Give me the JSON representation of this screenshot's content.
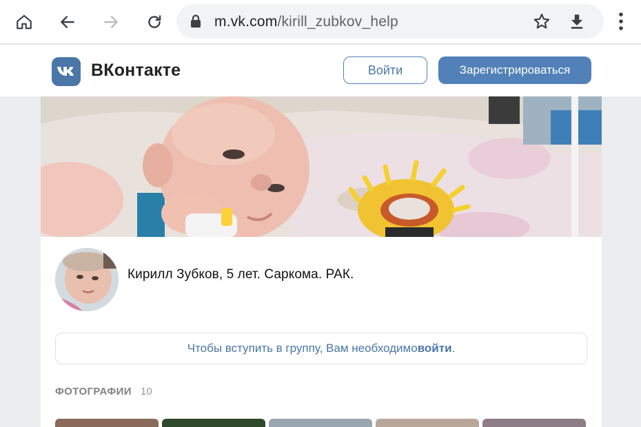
{
  "browser": {
    "url_host": "m.vk.com",
    "url_path": "/kirill_zubkov_help",
    "icons": [
      "home-icon",
      "back-icon",
      "forward-icon",
      "reload-icon",
      "lock-icon",
      "star-icon",
      "download-icon",
      "menu-icon"
    ]
  },
  "header": {
    "logo_text": "VK",
    "brand": "ВКонтакте",
    "login_label": "Войти",
    "register_label": "Зарегистрироваться"
  },
  "group": {
    "name": "Кирилл Зубков, 5 лет. Саркома. РАК.",
    "join_text": "Чтобы вступить в группу, Вам необходимо ",
    "join_link": "войти",
    "join_end": "."
  },
  "photos": {
    "title": "ФОТОГРАФИИ",
    "count": "10",
    "thumbs": [
      "#8a6a58",
      "#2f4a2a",
      "#9aa7b0",
      "#b9a79a",
      "#8e7c86"
    ]
  },
  "colors": {
    "accent": "#4a76a8",
    "button_primary": "#5181b8",
    "page_bg": "#ebedf0"
  }
}
